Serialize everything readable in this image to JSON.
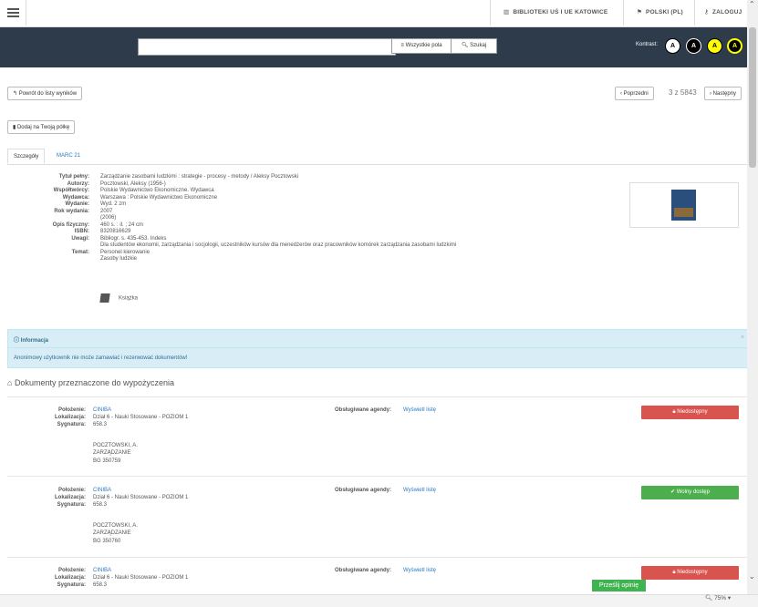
{
  "topbar": {
    "library": "BIBLIOTEKI UŚ I UE KATOWICE",
    "language": "POLSKI (PL)",
    "login": "ZALOGUJ"
  },
  "search": {
    "value": "",
    "field": "Wszystkie pola",
    "button": "Szukaj"
  },
  "contrast": {
    "label": "Kontrast:",
    "options": [
      "A",
      "A",
      "A",
      "A"
    ],
    "colors": [
      "#ffffff",
      "#000000",
      "#ffff00",
      "#ffff00"
    ]
  },
  "actions": {
    "back": "Powrót do listy wyników",
    "prev": "Poprzedni",
    "position": "3 z 5843",
    "next": "Następny",
    "shelf": "Dodaj na Twoją półkę"
  },
  "tabs": [
    "Szczegóły",
    "MARC 21"
  ],
  "details": {
    "title_label": "Tytuł pełny:",
    "title": "Zarządzanie zasobami ludzkimi : strategie - procesy - metody / Aleksy Pocztowski",
    "authors_label": "Autorzy:",
    "authors": "Pocztowski, Aleksy (1956-)",
    "co_label": "Współtwórcy:",
    "co": "Polskie Wydawnictwo Ekonomiczne. Wydawca",
    "publisher_label": "Wydawca:",
    "publisher": "Warszawa : Polskie Wydawnictwo Ekonomiczne",
    "edition_label": "Wydanie:",
    "edition": "Wyd. 2 zm",
    "year_label": "Rok wydania:",
    "year1": "2007",
    "year2": "(2006)",
    "phys_label": "Opis fizyczny:",
    "phys": "460 s. : il. ; 24 cm",
    "isbn_label": "ISBN:",
    "isbn": "8320816629",
    "notes_label": "Uwagi:",
    "note1": "Bibliogr. s. 435-453. Indeks",
    "note2": "Dla studentów ekonomii, zarządzania i socjologii, uczestników kursów dla menedżerów oraz pracowników komórek zarządzania zasobami ludzkimi",
    "subject_label": "Temat:",
    "subject1": "Personel kierowanie",
    "subject2": "Zasoby ludzkie",
    "format": "Książka"
  },
  "info": {
    "title": "Informacja",
    "message": "Anonimowy użytkownik nie może zamawiać i rezerwować dokumentów!",
    "close": "×"
  },
  "documents_heading": "Dokumenty przeznaczone do wypożyczenia",
  "items": [
    {
      "loc_label": "Położenie:",
      "loc": "CINIBA",
      "lok_label": "Lokalizacja:",
      "lok": "Dział 6 - Nauki Stosowane - POZIOM 1",
      "sig_label": "Sygnatura:",
      "sig": "658.3",
      "l1": "POCZTOWSKI, A.",
      "l2": "ZARZĄDZANIE",
      "l3": "BG 350759",
      "agendy": "Obsługiwane agendy:",
      "list": "Wyświetl listę",
      "status": "Niedostępny",
      "status_color": "#d9534f"
    },
    {
      "loc_label": "Położenie:",
      "loc": "CINIBA",
      "lok_label": "Lokalizacja:",
      "lok": "Dział 6 - Nauki Stosowane - POZIOM 1",
      "sig_label": "Sygnatura:",
      "sig": "658.3",
      "l1": "POCZTOWSKI, A.",
      "l2": "ZARZĄDZANIE",
      "l3": "BG 350760",
      "agendy": "Obsługiwane agendy:",
      "list": "Wyświetl listę",
      "status": "Wolny dostęp",
      "status_color": "#4cae4c"
    },
    {
      "loc_label": "Położenie:",
      "loc": "CINIBA",
      "lok_label": "Lokalizacja:",
      "lok": "Dział 6 - Nauki Stosowane - POZIOM 1",
      "sig_label": "Sygnatura:",
      "sig": "658.3",
      "agendy": "Obsługiwane agendy:",
      "list": "Wyświetl listę",
      "status": "Niedostępny",
      "status_color": "#d9534f"
    }
  ],
  "feedback": "Prześlij opinię",
  "zoom": "75%"
}
